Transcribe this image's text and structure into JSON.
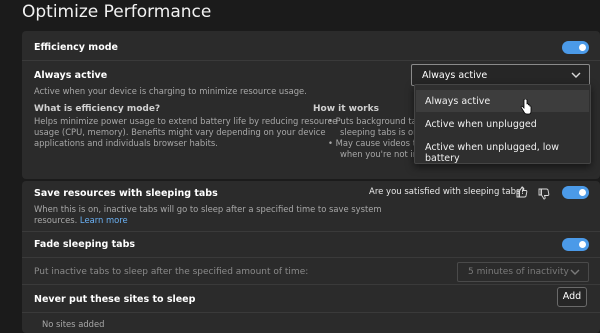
{
  "page_title": "Optimize Performance",
  "efficiency": {
    "label": "Efficiency mode",
    "toggle_on": true,
    "always_active_label": "Always active",
    "description": "Active when your device is charging to minimize resource usage.",
    "select_value": "Always active",
    "options": [
      "Always active",
      "Active when unplugged",
      "Active when unplugged, low battery"
    ],
    "what_is_heading": "What is efficiency mode?",
    "what_is_line1": "Helps minimize power usage to extend battery life by reducing resource",
    "what_is_line2": "usage (CPU, memory). Benefits might vary depending on your device",
    "what_is_line3": "applications and individuals browser habits.",
    "how_heading": "How it works",
    "how_line1": "Puts background ta",
    "how_line2": "sleeping tabs is on",
    "how_line3": "May cause videos t",
    "how_line4": "when you're not int"
  },
  "sleeping": {
    "label": "Save resources with sleeping tabs",
    "question": "Are you satisfied with sleeping tabs?",
    "toggle_on": true,
    "desc_line1": "When this is on, inactive tabs will go to sleep after a specified time to save system",
    "desc_line2": "resources.",
    "learn_more": "Learn more"
  },
  "fade": {
    "label": "Fade sleeping tabs",
    "toggle_on": true
  },
  "inactive": {
    "label": "Put inactive tabs to sleep after the specified amount of time:",
    "select_value": "5 minutes of inactivity"
  },
  "never_sleep": {
    "label": "Never put these sites to sleep",
    "add_label": "Add",
    "empty_text": "No sites added"
  },
  "icons": {
    "chevron": "chevron-down-icon",
    "thumbs_up": "thumbs-up-icon",
    "thumbs_down": "thumbs-down-icon",
    "cursor": "hand-cursor-icon"
  },
  "colors": {
    "accent": "#4b9ae8",
    "link": "#6ab0f3",
    "background": "#1b1b1b",
    "panel": "#2b2b2b"
  }
}
